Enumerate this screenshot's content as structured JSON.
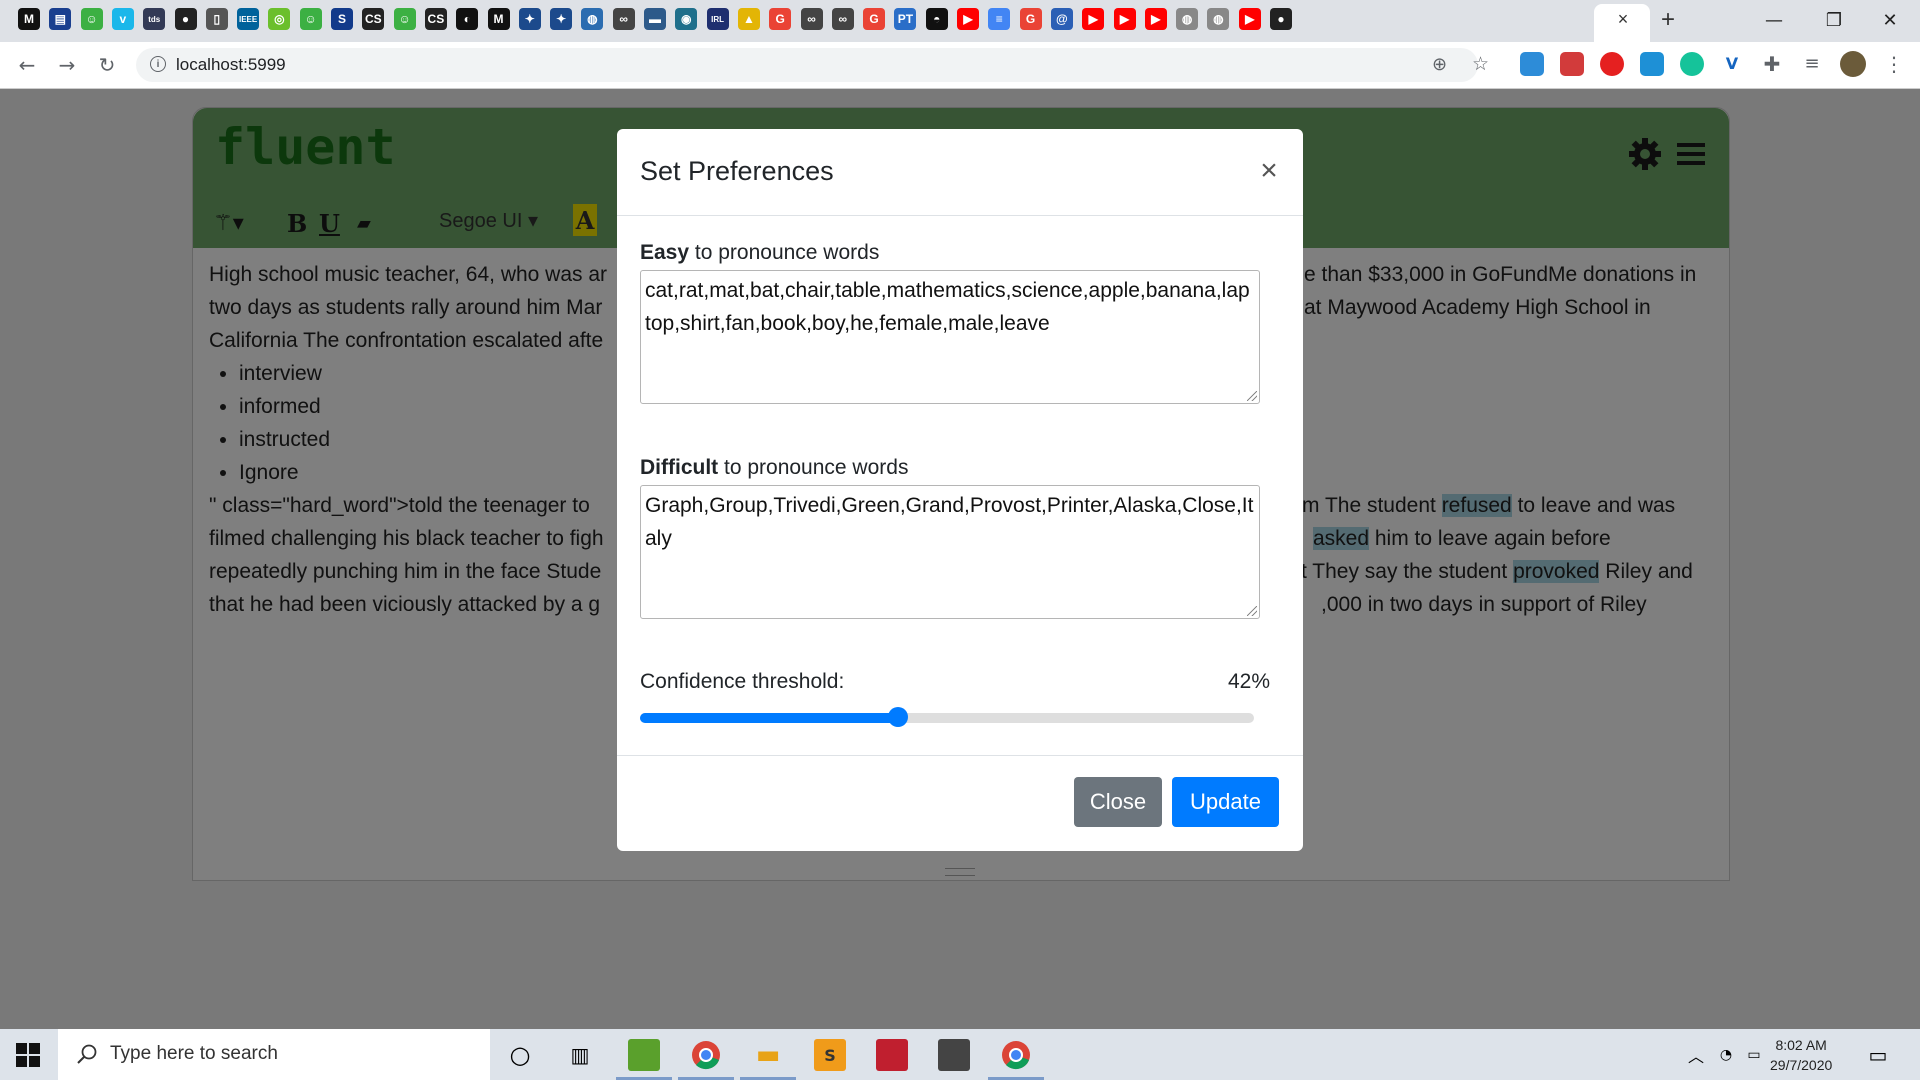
{
  "browser": {
    "tab_icons": [
      {
        "name": "medium-icon",
        "glyph": "M",
        "bg": "#111111"
      },
      {
        "name": "calendar-icon",
        "glyph": "▤",
        "bg": "#1a3f8f"
      },
      {
        "name": "smiley-icon",
        "glyph": "☺",
        "bg": "#3cb043"
      },
      {
        "name": "vimeo-icon",
        "glyph": "v",
        "bg": "#1ab7ea"
      },
      {
        "name": "tds-icon",
        "glyph": "tds",
        "bg": "#333a56"
      },
      {
        "name": "github-icon",
        "glyph": "●",
        "bg": "#222222"
      },
      {
        "name": "document-icon",
        "glyph": "▯",
        "bg": "#555555"
      },
      {
        "name": "ieee-icon",
        "glyph": "IEEE",
        "bg": "#00629b"
      },
      {
        "name": "circle-green-icon",
        "glyph": "◎",
        "bg": "#6bbf2c"
      },
      {
        "name": "smiley-icon-2",
        "glyph": "☺",
        "bg": "#3cb043"
      },
      {
        "name": "s-icon",
        "glyph": "S",
        "bg": "#123a8a"
      },
      {
        "name": "cs-icon",
        "glyph": "CS",
        "bg": "#222222"
      },
      {
        "name": "smiley-icon-3",
        "glyph": "☺",
        "bg": "#3cb043"
      },
      {
        "name": "cs-icon-2",
        "glyph": "CS",
        "bg": "#222222"
      },
      {
        "name": "medium-circle-icon",
        "glyph": "◐",
        "bg": "#111111"
      },
      {
        "name": "medium-icon-2",
        "glyph": "M",
        "bg": "#111111"
      },
      {
        "name": "ieee-tree-icon",
        "glyph": "✦",
        "bg": "#1c4a8c"
      },
      {
        "name": "ieee-tree-icon-2",
        "glyph": "✦",
        "bg": "#1c4a8c"
      },
      {
        "name": "globe-icon",
        "glyph": "◍",
        "bg": "#2b6cb0"
      },
      {
        "name": "link-icon",
        "glyph": "∞",
        "bg": "#444444"
      },
      {
        "name": "nvidia-icon",
        "glyph": "▬",
        "bg": "#2d5a8a"
      },
      {
        "name": "circle-logo-icon",
        "glyph": "◉",
        "bg": "#1f6f8b"
      },
      {
        "name": "iq-icon",
        "glyph": "IRL",
        "bg": "#1f2f6f"
      },
      {
        "name": "warning-icon",
        "glyph": "▲",
        "bg": "#e3b505"
      },
      {
        "name": "google-icon",
        "glyph": "G",
        "bg": "#ea4335"
      },
      {
        "name": "link-icon-2",
        "glyph": "∞",
        "bg": "#444444"
      },
      {
        "name": "link-icon-3",
        "glyph": "∞",
        "bg": "#444444"
      },
      {
        "name": "google-icon-2",
        "glyph": "G",
        "bg": "#ea4335"
      },
      {
        "name": "pt-icon",
        "glyph": "PT",
        "bg": "#2a6ec8"
      },
      {
        "name": "dark-icon",
        "glyph": "◓",
        "bg": "#111111"
      },
      {
        "name": "youtube-icon",
        "glyph": "▶",
        "bg": "#ff0000"
      },
      {
        "name": "docs-icon",
        "glyph": "≡",
        "bg": "#4285f4"
      },
      {
        "name": "google-icon-3",
        "glyph": "G",
        "bg": "#ea4335"
      },
      {
        "name": "at-icon",
        "glyph": "@",
        "bg": "#2b5fb5"
      },
      {
        "name": "youtube-icon-2",
        "glyph": "▶",
        "bg": "#ff0000"
      },
      {
        "name": "youtube-icon-3",
        "glyph": "▶",
        "bg": "#ff0000"
      },
      {
        "name": "youtube-icon-4",
        "glyph": "▶",
        "bg": "#ff0000"
      },
      {
        "name": "gray-globe-icon",
        "glyph": "◍",
        "bg": "#888888"
      },
      {
        "name": "gray-globe-icon-2",
        "glyph": "◍",
        "bg": "#888888"
      },
      {
        "name": "youtube-icon-5",
        "glyph": "▶",
        "bg": "#ff0000"
      },
      {
        "name": "github-icon-2",
        "glyph": "●",
        "bg": "#222222"
      }
    ],
    "active_tab_close": "×",
    "new_tab": "+",
    "url": "localhost:5999"
  },
  "app": {
    "brand": "fluent",
    "font_name": "Segoe UI",
    "bold_label": "B",
    "underline_label": "U",
    "color_label": "A",
    "doc_lines_left": [
      "High school music teacher, 64, who was ar",
      "two days as students rally around him Mar",
      "California The confrontation escalated afte"
    ],
    "bullets": [
      "interview",
      "informed",
      "instructed",
      "Ignore"
    ],
    "doc_lines_left2": [
      "\" class=\"hard_word\">told the teenager to",
      "filmed challenging his black teacher to figh",
      "repeatedly punching him in the face Stude",
      "that he had been viciously attacked by a g"
    ],
    "doc_lines_right": [
      "e than $33,000 in GoFundMe donations in",
      "at Maywood Academy High School in"
    ],
    "doc_lines_right2": [
      {
        "pre": "rm The student ",
        "hl": "refused",
        "post": " to leave and was"
      },
      {
        "pre": "",
        "hl": "asked",
        "post": " him to leave again before"
      },
      {
        "pre": "t They say the student ",
        "hl": "provoked",
        "post": " Riley and"
      },
      {
        "pre": ",000 in two days in support of Riley",
        "hl": "",
        "post": ""
      }
    ]
  },
  "modal": {
    "title": "Set Preferences",
    "close_x": "×",
    "easy_bold": "Easy",
    "easy_rest": " to pronounce words",
    "easy_value": "cat,rat,mat,bat,chair,table,mathematics,science,apple,banana,laptop,shirt,fan,book,boy,he,female,male,leave",
    "difficult_bold": "Difficult",
    "difficult_rest": " to pronounce words",
    "difficult_value": "Graph,Group,Trivedi,Green,Grand,Provost,Printer,Alaska,Close,Italy",
    "confidence_label": "Confidence threshold:",
    "confidence_value": "42%",
    "confidence_fraction": 0.42,
    "close_button": "Close",
    "update_button": "Update"
  },
  "taskbar": {
    "search_placeholder": "Type here to search",
    "time": "8:02 AM",
    "date": "29/7/2020"
  },
  "colors": {
    "accent": "#007bff",
    "header_green": "#6fa869",
    "brand_green": "#187018",
    "highlight": "#a9d6e5"
  }
}
